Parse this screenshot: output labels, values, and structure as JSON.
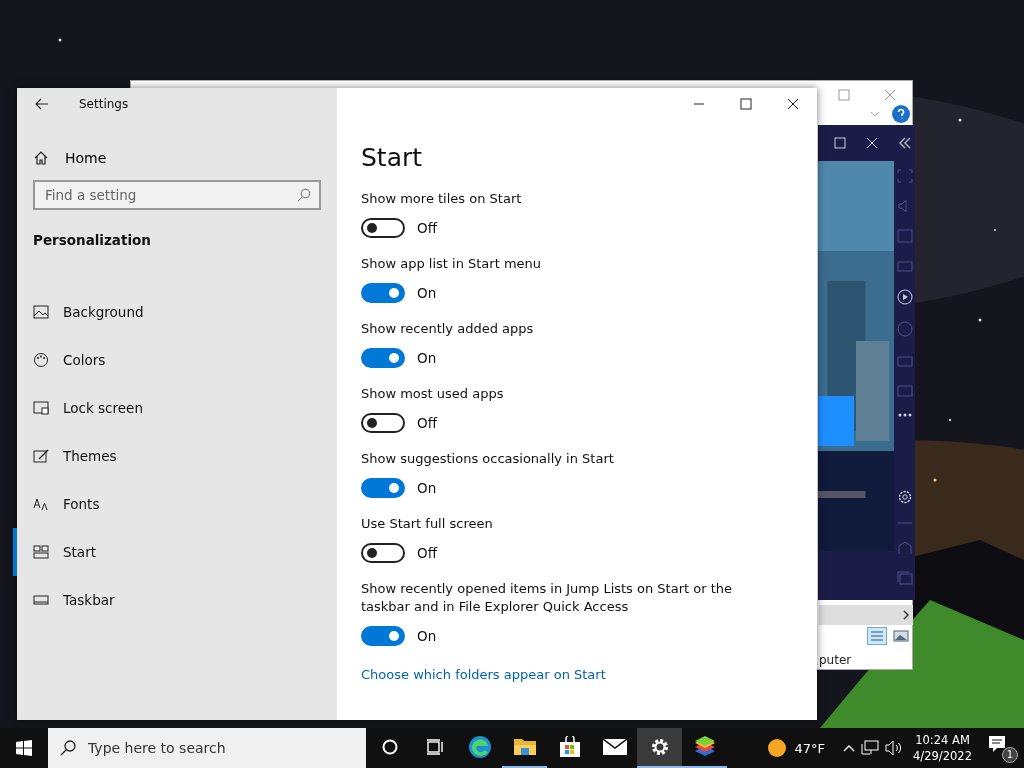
{
  "window": {
    "title": "Settings"
  },
  "sidebar": {
    "home": "Home",
    "search": {
      "placeholder": "Find a setting"
    },
    "section": "Personalization",
    "items": [
      {
        "label": "Background",
        "kind": "picture",
        "selected": false
      },
      {
        "label": "Colors",
        "kind": "palette",
        "selected": false
      },
      {
        "label": "Lock screen",
        "kind": "lock",
        "selected": false
      },
      {
        "label": "Themes",
        "kind": "brush",
        "selected": false
      },
      {
        "label": "Fonts",
        "kind": "font",
        "selected": false
      },
      {
        "label": "Start",
        "kind": "start",
        "selected": true
      },
      {
        "label": "Taskbar",
        "kind": "taskbar",
        "selected": false
      }
    ]
  },
  "page": {
    "title": "Start",
    "settings": [
      {
        "label": "Show more tiles on Start",
        "on": false,
        "state_text": "Off"
      },
      {
        "label": "Show app list in Start menu",
        "on": true,
        "state_text": "On"
      },
      {
        "label": "Show recently added apps",
        "on": true,
        "state_text": "On"
      },
      {
        "label": "Show most used apps",
        "on": false,
        "state_text": "Off"
      },
      {
        "label": "Show suggestions occasionally in Start",
        "on": true,
        "state_text": "On"
      },
      {
        "label": "Use Start full screen",
        "on": false,
        "state_text": "Off"
      },
      {
        "label": "Show recently opened items in Jump Lists on Start or the taskbar and in File Explorer Quick Access",
        "on": true,
        "state_text": "On"
      }
    ],
    "link": "Choose which folders appear on Start"
  },
  "background_window": {
    "status_text": "puter"
  },
  "taskbar": {
    "search": {
      "placeholder": "Type here to search"
    },
    "apps": [
      {
        "kind": "cortana",
        "running": false,
        "selected": false
      },
      {
        "kind": "taskview",
        "running": false,
        "selected": false
      },
      {
        "kind": "edge",
        "running": false,
        "selected": false
      },
      {
        "kind": "explorer",
        "running": true,
        "selected": false
      },
      {
        "kind": "store",
        "running": false,
        "selected": false
      },
      {
        "kind": "mail",
        "running": false,
        "selected": false
      },
      {
        "kind": "settings",
        "running": true,
        "selected": true
      },
      {
        "kind": "bluestacks",
        "running": true,
        "selected": false
      }
    ],
    "weather": "47°F",
    "time": "10:24 AM",
    "date": "4/29/2022",
    "notifications": "1"
  }
}
